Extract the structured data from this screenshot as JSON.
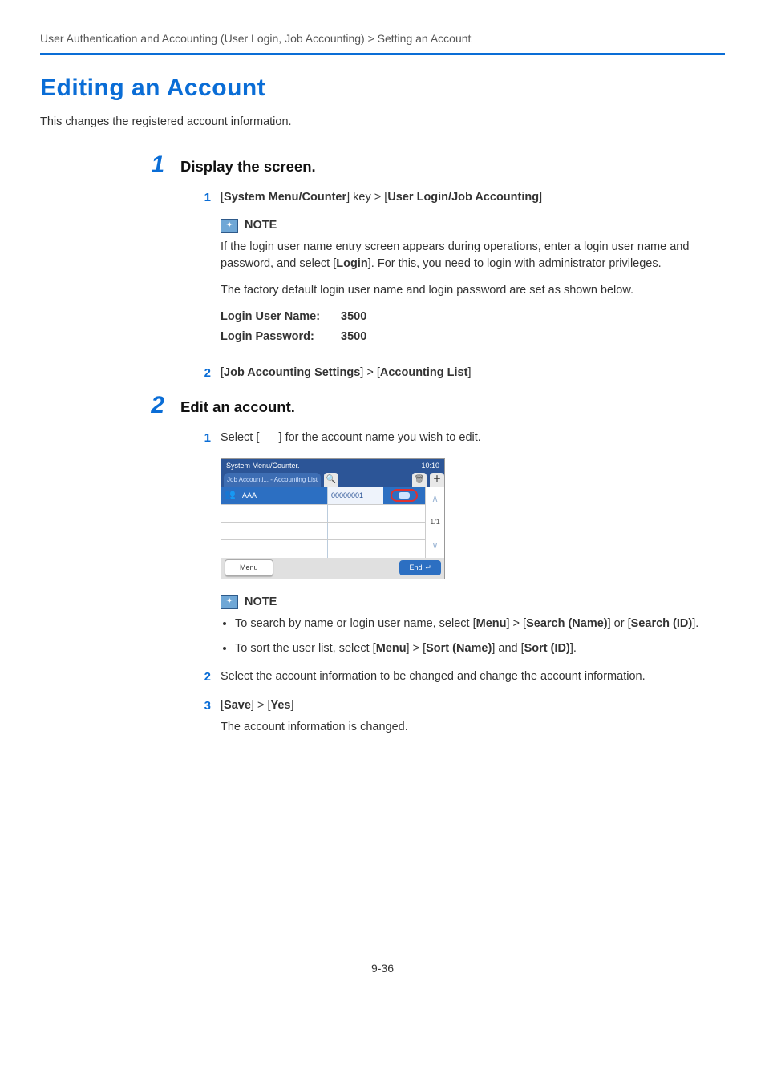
{
  "breadcrumb": "User Authentication and Accounting (User Login, Job Accounting) > Setting an Account",
  "title": "Editing an Account",
  "lead": "This changes the registered account information.",
  "step1": {
    "num": "1",
    "heading": "Display the screen.",
    "sub1_num": "1",
    "sub1_pre": "[",
    "sub1_b1": "System Menu/Counter",
    "sub1_mid": "] key > [",
    "sub1_b2": "User Login/Job Accounting",
    "sub1_post": "]",
    "note_label": "NOTE",
    "note_p1a": "If the login user name entry screen appears during operations, enter a login user name and password, and select [",
    "note_p1b": "Login",
    "note_p1c": "]. For this, you need to login with administrator privileges.",
    "note_p2": "The factory default login user name and login password are set as shown below.",
    "login_user_label": "Login User Name:",
    "login_user_value": "3500",
    "login_pass_label": "Login Password:",
    "login_pass_value": "3500",
    "sub2_num": "2",
    "sub2_pre": "[",
    "sub2_b1": "Job Accounting Settings",
    "sub2_mid": "] > [",
    "sub2_b2": "Accounting List",
    "sub2_post": "]"
  },
  "step2": {
    "num": "2",
    "heading": "Edit an account.",
    "sub1_num": "1",
    "sub1_text": "Select [      ] for the account name you wish to edit.",
    "device": {
      "top": "System Menu/Counter.",
      "tab": "Job Accounti... - Accounting List",
      "time": "10:10",
      "row_name": "AAA",
      "row_id": "00000001",
      "page": "1/1",
      "menu": "Menu",
      "end": "End"
    },
    "note_label": "NOTE",
    "bullet1a": "To search by name or login user name, select [",
    "bullet1b": "Menu",
    "bullet1c": "] > [",
    "bullet1d": "Search (Name)",
    "bullet1e": "] or [",
    "bullet1f": "Search (ID)",
    "bullet1g": "].",
    "bullet2a": "To sort the user list, select [",
    "bullet2b": "Menu",
    "bullet2c": "] > [",
    "bullet2d": "Sort (Name)",
    "bullet2e": "] and [",
    "bullet2f": "Sort (ID)",
    "bullet2g": "].",
    "sub2_num": "2",
    "sub2_text": "Select the account information to be changed and change the account information.",
    "sub3_num": "3",
    "sub3_pre": "[",
    "sub3_b1": "Save",
    "sub3_mid": "] > [",
    "sub3_b2": "Yes",
    "sub3_post": "]",
    "sub3_detail": "The account information is changed."
  },
  "pagenum": "9-36"
}
